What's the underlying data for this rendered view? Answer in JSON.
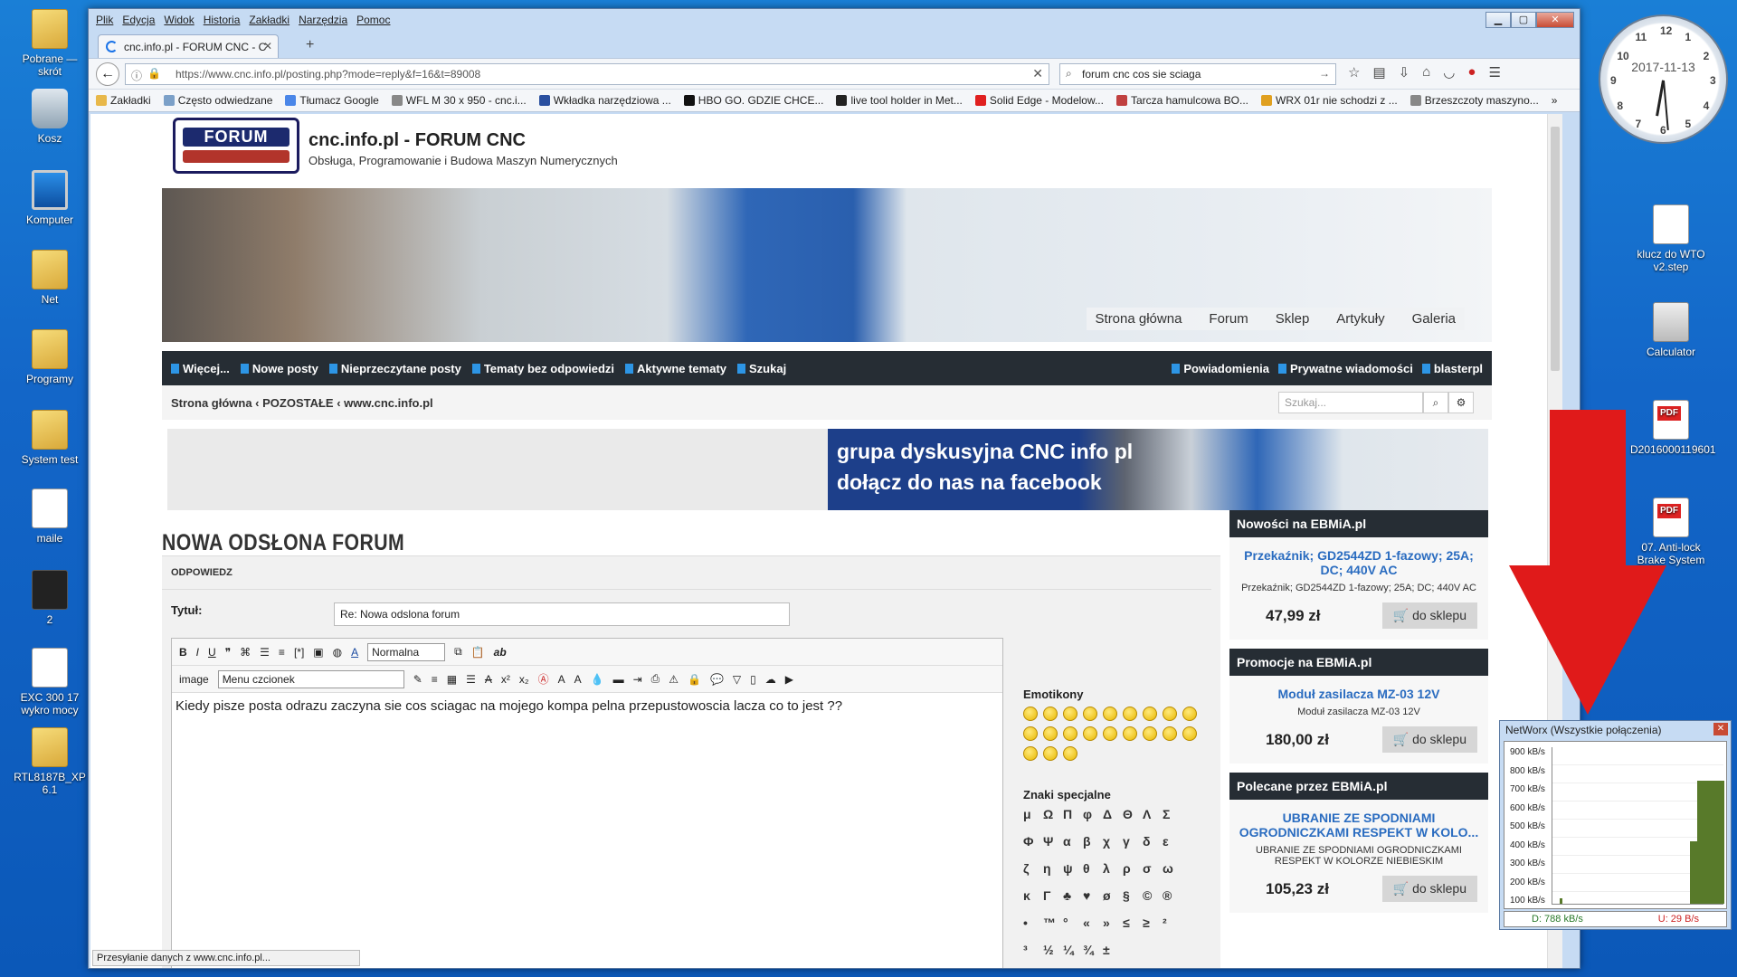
{
  "desktop": {
    "left_icons": [
      {
        "label": "Pobrane — skrót",
        "icon": "folder"
      },
      {
        "label": "Kosz",
        "icon": "bin"
      },
      {
        "label": "Komputer",
        "icon": "pc"
      },
      {
        "label": "Net",
        "icon": "folder"
      },
      {
        "label": "Programy",
        "icon": "folder"
      },
      {
        "label": "System test",
        "icon": "folder"
      },
      {
        "label": "maile",
        "icon": "doc"
      },
      {
        "label": "2",
        "icon": "dark"
      },
      {
        "label": "EXC 300 17 wykro mocy",
        "icon": "doc"
      },
      {
        "label": "RTL8187B_XP 6.1",
        "icon": "folder"
      }
    ],
    "right_icons": [
      {
        "label": "klucz do WTO v2.step",
        "icon": "doc"
      },
      {
        "label": "Calculator",
        "icon": "calc"
      },
      {
        "label": "D2016000119601",
        "icon": "pdf"
      },
      {
        "label": "07. Anti-lock Brake System",
        "icon": "pdf"
      }
    ],
    "clock_date": "2017-11-13",
    "clock_numbers": [
      "12",
      "1",
      "2",
      "3",
      "4",
      "5",
      "6",
      "7",
      "8",
      "9",
      "10",
      "11"
    ]
  },
  "browser": {
    "menu": [
      "Plik",
      "Edycja",
      "Widok",
      "Historia",
      "Zakładki",
      "Narzędzia",
      "Pomoc"
    ],
    "tab_title": "cnc.info.pl - FORUM CNC - C",
    "url": "https://www.cnc.info.pl/posting.php?mode=reply&f=16&t=89008",
    "search_value": "forum cnc cos sie sciaga",
    "bookmarks": [
      {
        "label": "Zakładki",
        "color": "#e8b84a"
      },
      {
        "label": "Często odwiedzane",
        "color": "#7ba0c8"
      },
      {
        "label": "Tłumacz Google",
        "color": "#4a86e8"
      },
      {
        "label": "WFL M 30 x 950 - cnc.i...",
        "color": "#888"
      },
      {
        "label": "Wkładka narzędziowa ...",
        "color": "#2a50a0"
      },
      {
        "label": "HBO GO. GDZIE CHCE...",
        "color": "#111"
      },
      {
        "label": "live tool holder in Met...",
        "color": "#222"
      },
      {
        "label": "Solid Edge - Modelow...",
        "color": "#e02020"
      },
      {
        "label": "Tarcza hamulcowa BO...",
        "color": "#c04040"
      },
      {
        "label": "WRX 01r nie schodzi z ...",
        "color": "#e0a020"
      },
      {
        "label": "Brzeszczoty maszyno...",
        "color": "#888"
      }
    ],
    "status_text": "Przesyłanie danych z www.cnc.info.pl..."
  },
  "site": {
    "title": "cnc.info.pl - FORUM CNC",
    "subtitle": "Obsługa, Programowanie i Budowa Maszyn Numerycznych",
    "logo_text": "FORUM",
    "hero_nav": [
      "Strona główna",
      "Forum",
      "Sklep",
      "Artykuły",
      "Galeria"
    ],
    "topbar_left": [
      "Więcej...",
      "Nowe posty",
      "Nieprzeczytane posty",
      "Tematy bez odpowiedzi",
      "Aktywne tematy",
      "Szukaj"
    ],
    "topbar_right": [
      "Powiadomienia",
      "Prywatne wiadomości",
      "blasterpl"
    ],
    "breadcrumbs": [
      "Strona główna",
      "POZOSTAŁE",
      "www.cnc.info.pl"
    ],
    "search_placeholder": "Szukaj...",
    "banner_line1": "grupa dyskusyjna CNC info pl",
    "banner_line2": "dołącz do nas na  facebook",
    "page_heading": "NOWA ODSŁONA FORUM",
    "reply_label": "ODPOWIEDZ",
    "title_label": "Tytuł:",
    "title_value": "Re: Nowa odslona forum",
    "editor_size": "Normalna",
    "editor_image_label": "image",
    "editor_font": "Menu czcionek",
    "message": "Kiedy pisze posta odrazu zaczyna sie cos sciagac na mojego kompa pelna przepustowoscia lacza co to jest ??",
    "emoticons_label": "Emotikony",
    "special_label": "Znaki specjalne",
    "special_chars": [
      "μ",
      "Ω",
      "Π",
      "φ",
      "Δ",
      "Θ",
      "Λ",
      "Σ",
      "Φ",
      "Ψ",
      "α",
      "β",
      "χ",
      "γ",
      "δ",
      "ε",
      "ζ",
      "η",
      "ψ",
      "θ",
      "λ",
      "ρ",
      "σ",
      "ω",
      "κ",
      "Γ",
      "♣",
      "♥",
      "ø",
      "§",
      "©",
      "®",
      "•",
      "™",
      "°",
      "«",
      "»",
      "≤",
      "≥",
      "²",
      "³",
      "½",
      "¼",
      "¾",
      "±"
    ]
  },
  "sidebar": {
    "blocks": [
      {
        "header": "Nowości na EBMiA.pl",
        "product": "Przekaźnik; GD2544ZD 1-fazowy; 25A; DC; 440V AC",
        "desc": "Przekaźnik; GD2544ZD 1-fazowy; 25A; DC; 440V AC",
        "price": "47,99 zł",
        "cart": "do sklepu"
      },
      {
        "header": "Promocje na EBMiA.pl",
        "product": "Moduł zasilacza MZ-03 12V",
        "desc": "Moduł zasilacza MZ-03 12V",
        "price": "180,00 zł",
        "cart": "do sklepu"
      },
      {
        "header": "Polecane przez EBMiA.pl",
        "product": "UBRANIE ZE SPODNIAMI OGRODNICZKAMI RESPEKT W KOLO...",
        "desc": "UBRANIE ZE SPODNIAMI OGRODNICZKAMI RESPEKT W KOLORZE NIEBIESKIM",
        "price": "105,23 zł",
        "cart": "do sklepu"
      }
    ]
  },
  "networx": {
    "title": "NetWorx (Wszystkie połączenia)",
    "axis_labels": [
      "900 kB/s",
      "800 kB/s",
      "700 kB/s",
      "600 kB/s",
      "500 kB/s",
      "400 kB/s",
      "300 kB/s",
      "200 kB/s",
      "100 kB/s"
    ],
    "download": "D: 788 kB/s",
    "upload": "U: 29 B/s",
    "bar_color": "#587a2a",
    "current_download_kbs": 788
  }
}
